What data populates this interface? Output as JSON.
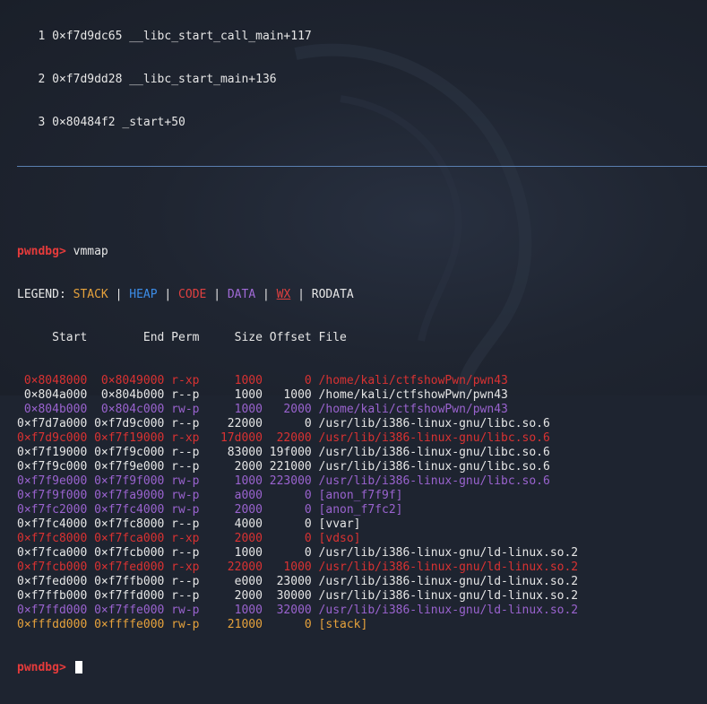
{
  "backtrace": [
    {
      "index": "1",
      "text": "0×f7d9dc65 __libc_start_call_main+117"
    },
    {
      "index": "2",
      "text": "0×f7d9dd28 __libc_start_main+136"
    },
    {
      "index": "3",
      "text": "0×80484f2 _start+50"
    }
  ],
  "prompt": "pwndbg>",
  "command": "vmmap",
  "legend": {
    "label": "LEGEND:",
    "stack": "STACK",
    "heap": "HEAP",
    "code": "CODE",
    "data": "DATA",
    "wx": "WX",
    "rodata": "RODATA",
    "sep": "|"
  },
  "header": "     Start        End Perm     Size Offset File",
  "rows": [
    {
      "type": "code",
      "text": " 0×8048000  0×8049000 r-xp     1000      0 /home/kali/ctfshowPwn/pwn43"
    },
    {
      "type": "ro",
      "text": " 0×804a000  0×804b000 r--p     1000   1000 /home/kali/ctfshowPwn/pwn43"
    },
    {
      "type": "data",
      "text": " 0×804b000  0×804c000 rw-p     1000   2000 /home/kali/ctfshowPwn/pwn43"
    },
    {
      "type": "ro",
      "text": "0×f7d7a000 0×f7d9c000 r--p    22000      0 /usr/lib/i386-linux-gnu/libc.so.6"
    },
    {
      "type": "code",
      "text": "0×f7d9c000 0×f7f19000 r-xp   17d000  22000 /usr/lib/i386-linux-gnu/libc.so.6"
    },
    {
      "type": "ro",
      "text": "0×f7f19000 0×f7f9c000 r--p    83000 19f000 /usr/lib/i386-linux-gnu/libc.so.6"
    },
    {
      "type": "ro",
      "text": "0×f7f9c000 0×f7f9e000 r--p     2000 221000 /usr/lib/i386-linux-gnu/libc.so.6"
    },
    {
      "type": "data",
      "text": "0×f7f9e000 0×f7f9f000 rw-p     1000 223000 /usr/lib/i386-linux-gnu/libc.so.6"
    },
    {
      "type": "data",
      "text": "0×f7f9f000 0×f7fa9000 rw-p     a000      0 [anon_f7f9f]"
    },
    {
      "type": "data",
      "text": "0×f7fc2000 0×f7fc4000 rw-p     2000      0 [anon_f7fc2]"
    },
    {
      "type": "ro",
      "text": "0×f7fc4000 0×f7fc8000 r--p     4000      0 [vvar]"
    },
    {
      "type": "code",
      "text": "0×f7fc8000 0×f7fca000 r-xp     2000      0 [vdso]"
    },
    {
      "type": "ro",
      "text": "0×f7fca000 0×f7fcb000 r--p     1000      0 /usr/lib/i386-linux-gnu/ld-linux.so.2"
    },
    {
      "type": "code",
      "text": "0×f7fcb000 0×f7fed000 r-xp    22000   1000 /usr/lib/i386-linux-gnu/ld-linux.so.2"
    },
    {
      "type": "ro",
      "text": "0×f7fed000 0×f7ffb000 r--p     e000  23000 /usr/lib/i386-linux-gnu/ld-linux.so.2"
    },
    {
      "type": "ro",
      "text": "0×f7ffb000 0×f7ffd000 r--p     2000  30000 /usr/lib/i386-linux-gnu/ld-linux.so.2"
    },
    {
      "type": "data",
      "text": "0×f7ffd000 0×f7ffe000 rw-p     1000  32000 /usr/lib/i386-linux-gnu/ld-linux.so.2"
    },
    {
      "type": "stack",
      "text": "0×fffdd000 0×ffffe000 rw-p    21000      0 [stack]"
    }
  ],
  "colors": {
    "background": "#1e2430",
    "prompt": "#e63b3b",
    "stack": "#e6a23c",
    "heap": "#3c8ce6",
    "code": "#d93232",
    "data": "#9a63cf",
    "text": "#e6e6e6",
    "divider": "#5a7fb0"
  }
}
